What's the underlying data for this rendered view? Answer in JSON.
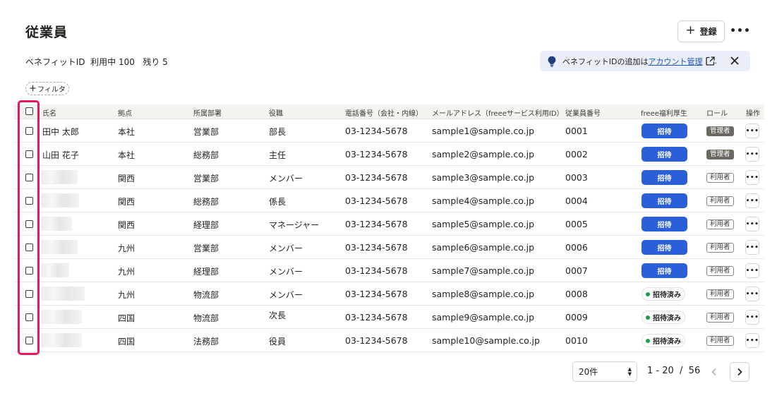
{
  "page": {
    "title": "従業員",
    "register_label": "登録",
    "more_label": "•••",
    "benefit_info": "ベネフィットID  利用中 100   残り 5",
    "filter_label": "フィルタ"
  },
  "notice": {
    "text_before": "ベネフィットIDの追加は",
    "link_text": "アカウント管理",
    "text_after": "."
  },
  "table": {
    "columns": {
      "name": "氏名",
      "location": "拠点",
      "department": "所属部署",
      "position": "役職",
      "phone": "電話番号（会社・内線）",
      "email": "メールアドレス（freeeサービス利用ID）",
      "employee_no": "従業員番号",
      "benefit": "freee福利厚生",
      "role": "ロール",
      "actions": "操作"
    },
    "invite_label": "招待",
    "invited_label": "招待済み",
    "ops_label": "•••",
    "rows": [
      {
        "name": "田中 太郎",
        "location": "本社",
        "department": "営業部",
        "position": "部長",
        "phone": "03-1234-5678",
        "email": "sample1@sample.co.jp",
        "employee_no": "0001",
        "benefit_status": "invite",
        "role": "管理者",
        "role_type": "admin"
      },
      {
        "name": "山田 花子",
        "location": "本社",
        "department": "総務部",
        "position": "主任",
        "phone": "03-1234-5678",
        "email": "sample2@sample.co.jp",
        "employee_no": "0002",
        "benefit_status": "invite",
        "role": "管理者",
        "role_type": "admin"
      },
      {
        "name": "",
        "location": "関西",
        "department": "営業部",
        "position": "メンバー",
        "phone": "03-1234-5678",
        "email": "sample3@sample.co.jp",
        "employee_no": "0003",
        "benefit_status": "invite",
        "role": "利用者",
        "role_type": "user"
      },
      {
        "name": "",
        "location": "関西",
        "department": "総務部",
        "position": "係長",
        "phone": "03-1234-5678",
        "email": "sample4@sample.co.jp",
        "employee_no": "0004",
        "benefit_status": "invite",
        "role": "利用者",
        "role_type": "user"
      },
      {
        "name": "",
        "location": "関西",
        "department": "経理部",
        "position": "マネージャー",
        "phone": "03-1234-5678",
        "email": "sample5@sample.co.jp",
        "employee_no": "0005",
        "benefit_status": "invite",
        "role": "利用者",
        "role_type": "user"
      },
      {
        "name": "",
        "location": "九州",
        "department": "営業部",
        "position": "メンバー",
        "phone": "03-1234-5678",
        "email": "sample6@sample.co.jp",
        "employee_no": "0006",
        "benefit_status": "invite",
        "role": "利用者",
        "role_type": "user"
      },
      {
        "name": "",
        "location": "九州",
        "department": "経理部",
        "position": "メンバー",
        "phone": "03-1234-5678",
        "email": "sample7@sample.co.jp",
        "employee_no": "0007",
        "benefit_status": "invite",
        "role": "利用者",
        "role_type": "user"
      },
      {
        "name": "",
        "location": "九州",
        "department": "物流部",
        "position": "メンバー",
        "phone": "03-1234-5678",
        "email": "sample8@sample.co.jp",
        "employee_no": "0008",
        "benefit_status": "invited",
        "role": "利用者",
        "role_type": "user"
      },
      {
        "name": "",
        "location": "四国",
        "department": "物流部",
        "position": "次長",
        "phone": "03-1234-5678",
        "email": "sample9@sample.co.jp",
        "employee_no": "0009",
        "benefit_status": "invited",
        "role": "利用者",
        "role_type": "user"
      },
      {
        "name": "",
        "location": "四国",
        "department": "法務部",
        "position": "役員",
        "phone": "03-1234-5678",
        "email": "sample10@sample.co.jp",
        "employee_no": "0010",
        "benefit_status": "invited",
        "role": "利用者",
        "role_type": "user"
      }
    ]
  },
  "pagination": {
    "per_page": "20件",
    "range": "1 - 20  /  56"
  }
}
